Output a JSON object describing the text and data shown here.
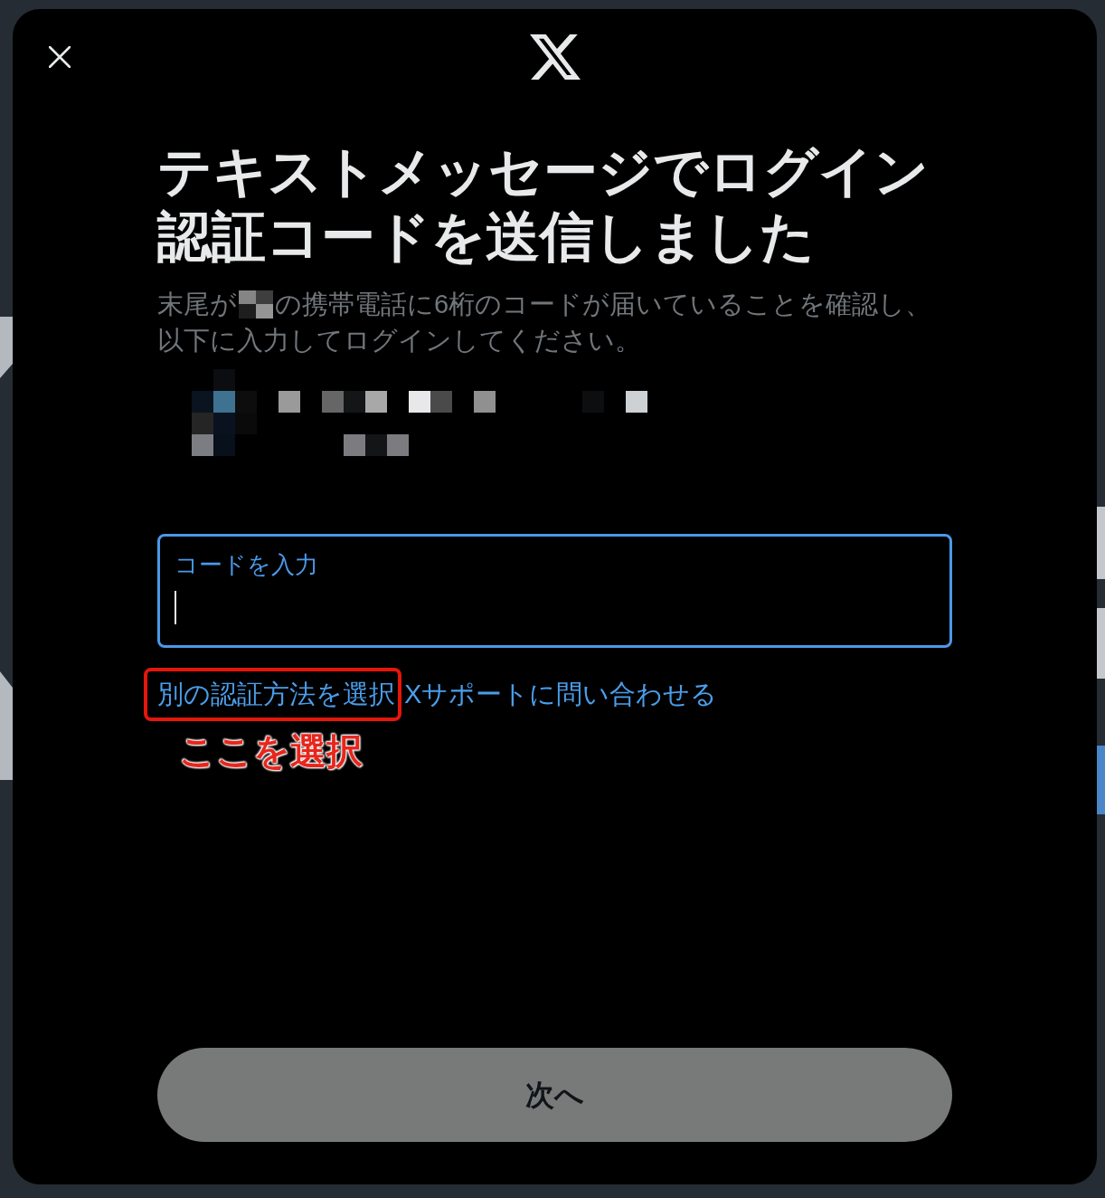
{
  "title": "テキストメッセージでログイン認証コードを送信しました",
  "description": {
    "before": "末尾が",
    "after": "の携帯電話に6桁のコードが届いていることを確認し、以下に入力してログインしてください。"
  },
  "code_field": {
    "label": "コードを入力",
    "focused": true
  },
  "links": [
    {
      "label": "別の認証方法を選択",
      "highlighted": true
    },
    {
      "label": "Xサポートに問い合わせる",
      "highlighted": false
    }
  ],
  "annotation": {
    "label": "ここを選択"
  },
  "next_button": {
    "label": "次へ",
    "disabled": true
  }
}
